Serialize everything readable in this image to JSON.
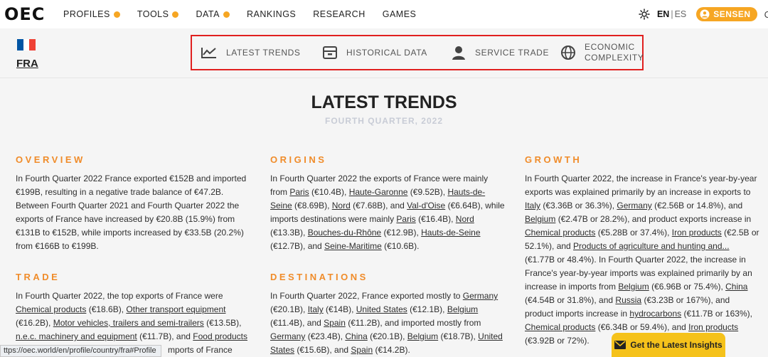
{
  "header": {
    "logo": "OEC",
    "nav": [
      {
        "label": "PROFILES",
        "dot": true
      },
      {
        "label": "TOOLS",
        "dot": true
      },
      {
        "label": "DATA",
        "dot": true
      },
      {
        "label": "RANKINGS",
        "dot": false
      },
      {
        "label": "RESEARCH",
        "dot": false
      },
      {
        "label": "GAMES",
        "dot": false
      }
    ],
    "lang_active": "EN",
    "lang_sep": "|",
    "lang_other": "ES",
    "user": "SENSEN",
    "cut_icon_char": "C"
  },
  "profile": {
    "country_code": "FRA",
    "flag_colors": [
      "#0055A4",
      "#FFFFFF",
      "#EF4135"
    ],
    "sections": [
      {
        "label": "LATEST TRENDS",
        "icon": "line-chart-icon"
      },
      {
        "label": "HISTORICAL DATA",
        "icon": "archive-icon"
      },
      {
        "label": "SERVICE TRADE",
        "icon": "person-icon"
      },
      {
        "label_line1": "ECONOMIC",
        "label_line2": "COMPLEXITY",
        "icon": "globe-icon"
      }
    ]
  },
  "page": {
    "title": "LATEST TRENDS",
    "subtitle": "FOURTH QUARTER, 2022"
  },
  "overview": {
    "heading": "OVERVIEW",
    "text": "In Fourth Quarter 2022 France exported €152B and imported €199B, resulting in a negative trade balance of €47.2B. Between Fourth Quarter 2021 and Fourth Quarter 2022 the exports of France have increased by €20.8B (15.9%) from €131B to €152B, while imports increased by €33.5B (20.2%) from €166B to €199B."
  },
  "trade": {
    "heading": "TRADE",
    "t1": "In Fourth Quarter 2022, the top exports of France were ",
    "l1": "Chemical products",
    "t2": " (€18.6B), ",
    "l2": "Other transport equipment",
    "t3": " (€16.2B), ",
    "l3": "Motor vehicles, trailers and semi-trailers",
    "t4": " (€13.5B), ",
    "l4": "n.e.c. machinery and equipment",
    "t5": " (€11.7B), and ",
    "l5": "Food products",
    "t6": " ",
    "tail": "mports of France were"
  },
  "origins": {
    "heading": "ORIGINS",
    "t1": "In Fourth Quarter 2022 the exports of France were mainly from ",
    "l1": "Paris",
    "t2": " (€10.4B), ",
    "l2": "Haute-Garonne",
    "t3": " (€9.52B), ",
    "l3": "Hauts-de-Seine",
    "t4": " (€8.69B), ",
    "l4": "Nord",
    "t5": " (€7.68B), and ",
    "l5": "Val-d'Oise",
    "t6": " (€6.64B), while imports destinations were mainly ",
    "l6": "Paris",
    "t7": " (€16.4B), ",
    "l7": "Nord",
    "t8": " (€13.3B), ",
    "l8": "Bouches-du-Rhône",
    "t9": " (€12.9B), ",
    "l9": "Hauts-de-Seine",
    "t10": " (€12.7B), and ",
    "l10": "Seine-Maritime",
    "t11": " (€10.6B)."
  },
  "destinations": {
    "heading": "DESTINATIONS",
    "t1": "In Fourth Quarter 2022, France exported mostly to ",
    "l1": "Germany",
    "t2": " (€20.1B), ",
    "l2": "Italy",
    "t3": " (€14B), ",
    "l3": "United States",
    "t4": " (€12.1B), ",
    "l4": "Belgium",
    "t5": " (€11.4B), and ",
    "l5": "Spain",
    "t6": " (€11.2B), and imported mostly from ",
    "l6": "Germany",
    "t7": " (€23.4B), ",
    "l7": "China",
    "t8": " (€20.1B), ",
    "l8": "Belgium",
    "t9": " (€18.7B), ",
    "l9": "United States",
    "t10": " (€15.6B), and ",
    "l10": "Spain",
    "t11": " (€14.2B)."
  },
  "growth": {
    "heading": "GROWTH",
    "t1": "In Fourth Quarter 2022, the increase in France's year-by-year exports was explained primarily by an increase in exports to ",
    "l1": "Italy",
    "t2": " (€3.36B or 36.3%), ",
    "l2": "Germany",
    "t3": " (€2.56B or 14.8%), and ",
    "l3": "Belgium",
    "t4": " (€2.47B or 28.2%), and product exports increase in ",
    "l4": "Chemical products",
    "t5": " (€5.28B or 37.4%), ",
    "l5": "Iron products",
    "t6": " (€2.5B or 52.1%), and ",
    "l6": "Products of agriculture and hunting and...",
    "t7": " (€1.77B or 48.4%). In Fourth Quarter 2022, the increase in France's year-by-year imports was explained primarily by an increase in imports from ",
    "l7": "Belgium",
    "t8": " (€6.96B or 75.4%), ",
    "l8": "China",
    "t9": " (€4.54B or 31.8%), and ",
    "l9": "Russia",
    "t10": " (€3.23B or 167%), and product imports increase in ",
    "l10": "hydrocarbons",
    "t11": " (€11.7B or 163%), ",
    "l11": "Chemical products",
    "t12": " (€6.34B or 59.4%), and ",
    "l12": "Iron products",
    "t13": " (€3.92B or 72%)."
  },
  "status_url": "ttps://oec.world/en/profile/country/fra#Profile",
  "cta": {
    "label": "Get the Latest Insights",
    "icon": "envelope-icon"
  },
  "colors": {
    "accent": "#f6a623",
    "heading": "#f08c2a",
    "highlight": "#e0201f",
    "cta": "#f5c21b"
  }
}
